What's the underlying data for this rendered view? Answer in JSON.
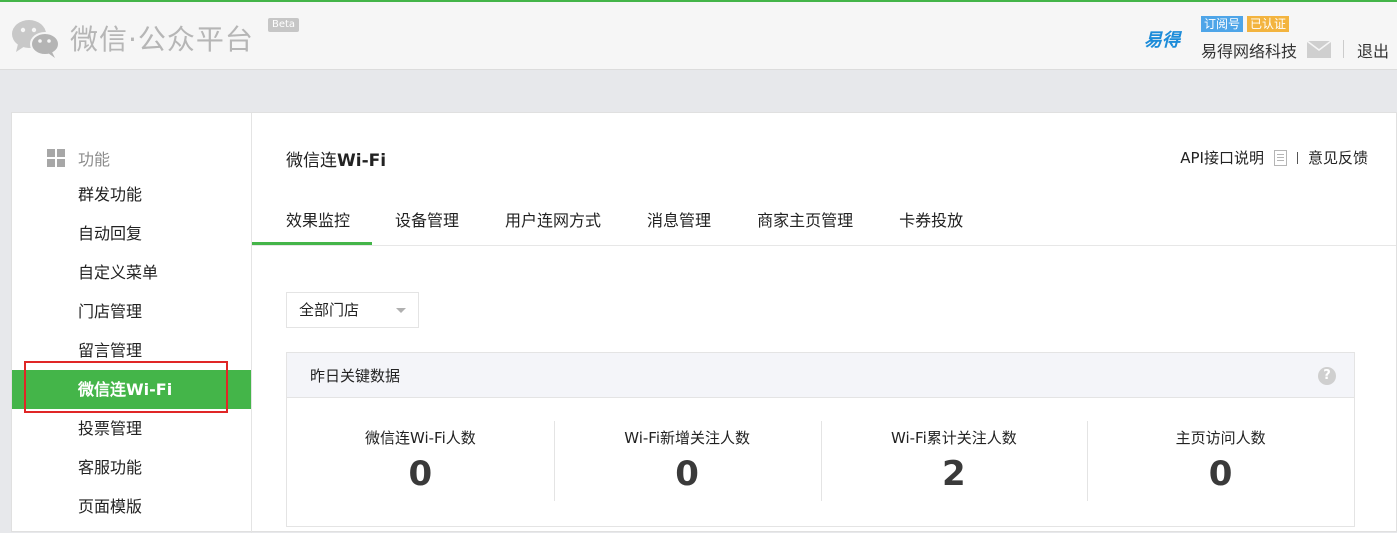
{
  "header": {
    "title": "微信·公众平台",
    "beta": "Beta",
    "brand_logo": "易得",
    "badge_subscription": "订阅号",
    "badge_verified": "已认证",
    "account_name": "易得网络科技",
    "logout": "退出"
  },
  "sidebar": {
    "section_title": "功能",
    "items": [
      {
        "label": "群发功能"
      },
      {
        "label": "自动回复"
      },
      {
        "label": "自定义菜单"
      },
      {
        "label": "门店管理"
      },
      {
        "label": "留言管理"
      },
      {
        "label": "微信连Wi-Fi"
      },
      {
        "label": "投票管理"
      },
      {
        "label": "客服功能"
      },
      {
        "label": "页面模版"
      }
    ],
    "active_index": 5
  },
  "main": {
    "title_prefix": "微信连",
    "title_bold": "Wi-Fi",
    "api_link": "API接口说明",
    "feedback_link": "意见反馈",
    "tabs": [
      {
        "label": "效果监控"
      },
      {
        "label": "设备管理"
      },
      {
        "label": "用户连网方式"
      },
      {
        "label": "消息管理"
      },
      {
        "label": "商家主页管理"
      },
      {
        "label": "卡券投放"
      }
    ],
    "store_select": "全部门店",
    "stats_title": "昨日关键数据",
    "stats": [
      {
        "label": "微信连Wi-Fi人数",
        "value": "0"
      },
      {
        "label": "Wi-Fi新增关注人数",
        "value": "0"
      },
      {
        "label": "Wi-Fi累计关注人数",
        "value": "2"
      },
      {
        "label": "主页访问人数",
        "value": "0"
      }
    ]
  },
  "colors": {
    "accent": "#44b549",
    "highlight_border": "#e02626"
  }
}
